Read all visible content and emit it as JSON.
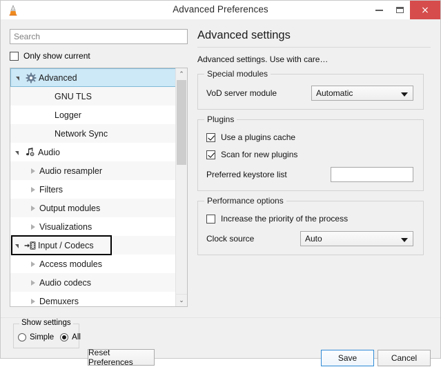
{
  "window": {
    "title": "Advanced Preferences",
    "app_icon": "vlc-cone-icon",
    "buttons": {
      "minimize": "minimize-icon",
      "maximize": "maximize-icon",
      "close": "×"
    }
  },
  "sidebar": {
    "search": {
      "placeholder": "Search",
      "value": ""
    },
    "only_show_current": {
      "label": "Only show current",
      "checked": false
    },
    "tree": [
      {
        "label": "Advanced",
        "icon": "gear-icon",
        "level": 0,
        "expander": "open",
        "selected": true,
        "alt": false
      },
      {
        "label": "GNU TLS",
        "icon": "",
        "level": 1,
        "expander": "none",
        "selected": false,
        "alt": true
      },
      {
        "label": "Logger",
        "icon": "",
        "level": 1,
        "expander": "none",
        "selected": false,
        "alt": false
      },
      {
        "label": "Network Sync",
        "icon": "",
        "level": 1,
        "expander": "none",
        "selected": false,
        "alt": true
      },
      {
        "label": "Audio",
        "icon": "audio-note-icon",
        "level": 0,
        "expander": "open",
        "selected": false,
        "alt": false
      },
      {
        "label": "Audio resampler",
        "icon": "",
        "level": 1,
        "expander": "closed",
        "selected": false,
        "alt": true
      },
      {
        "label": "Filters",
        "icon": "",
        "level": 1,
        "expander": "closed",
        "selected": false,
        "alt": false
      },
      {
        "label": "Output modules",
        "icon": "",
        "level": 1,
        "expander": "closed",
        "selected": false,
        "alt": true
      },
      {
        "label": "Visualizations",
        "icon": "",
        "level": 1,
        "expander": "closed",
        "selected": false,
        "alt": false
      },
      {
        "label": "Input / Codecs",
        "icon": "input-codecs-icon",
        "level": 0,
        "expander": "open",
        "selected": false,
        "alt": true
      },
      {
        "label": "Access modules",
        "icon": "",
        "level": 1,
        "expander": "closed",
        "selected": false,
        "alt": false
      },
      {
        "label": "Audio codecs",
        "icon": "",
        "level": 1,
        "expander": "closed",
        "selected": false,
        "alt": true
      },
      {
        "label": "Demuxers",
        "icon": "",
        "level": 1,
        "expander": "closed",
        "selected": false,
        "alt": false
      }
    ],
    "highlighted_item": "Input / Codecs",
    "scrollbar": {
      "up": "⌃",
      "down": "⌄"
    }
  },
  "main": {
    "title": "Advanced settings",
    "description": "Advanced settings. Use with care…",
    "groups": {
      "special_modules": {
        "title": "Special modules",
        "vod_label": "VoD server module",
        "vod_value": "Automatic"
      },
      "plugins": {
        "title": "Plugins",
        "use_cache_label": "Use a plugins cache",
        "use_cache_checked": true,
        "scan_label": "Scan for new plugins",
        "scan_checked": true,
        "keystore_label": "Preferred keystore list",
        "keystore_value": "",
        "keystore_placeholder": ""
      },
      "performance": {
        "title": "Performance options",
        "priority_label": "Increase the priority of the process",
        "priority_checked": false,
        "clock_label": "Clock source",
        "clock_value": "Auto"
      }
    }
  },
  "footer": {
    "show_settings_title": "Show settings",
    "simple_label": "Simple",
    "all_label": "All",
    "selected_mode": "All",
    "reset_label": "Reset Preferences",
    "save_label": "Save",
    "cancel_label": "Cancel"
  },
  "colors": {
    "accent_selection": "#cde8f6",
    "close_button": "#d64c4c",
    "focus_border": "#2e8ad6",
    "window_bg": "#f0f0f0"
  }
}
